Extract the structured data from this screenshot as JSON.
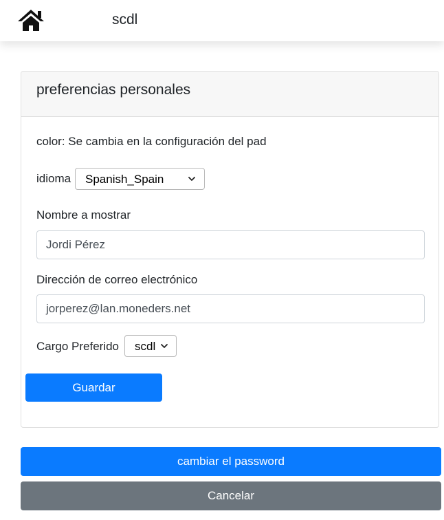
{
  "header": {
    "title": "scdl",
    "home_icon": "home-icon"
  },
  "card": {
    "title": "preferencias personales",
    "color_note": "color: Se cambia en la configuración del pad",
    "language": {
      "label": "idioma",
      "selected": "Spanish_Spain"
    },
    "display_name": {
      "label": "Nombre a mostrar",
      "value": "Jordi Pérez"
    },
    "email": {
      "label": "Dirección de correo electrónico",
      "value": "jorperez@lan.moneders.net"
    },
    "role": {
      "label": "Cargo Preferido",
      "selected": "scdl"
    },
    "save_label": "Guardar"
  },
  "actions": {
    "change_password_label": "cambiar el password",
    "cancel_label": "Cancelar"
  },
  "colors": {
    "primary": "#0a7bff",
    "secondary": "#6c757d",
    "header_bg": "#f7f7f7"
  }
}
